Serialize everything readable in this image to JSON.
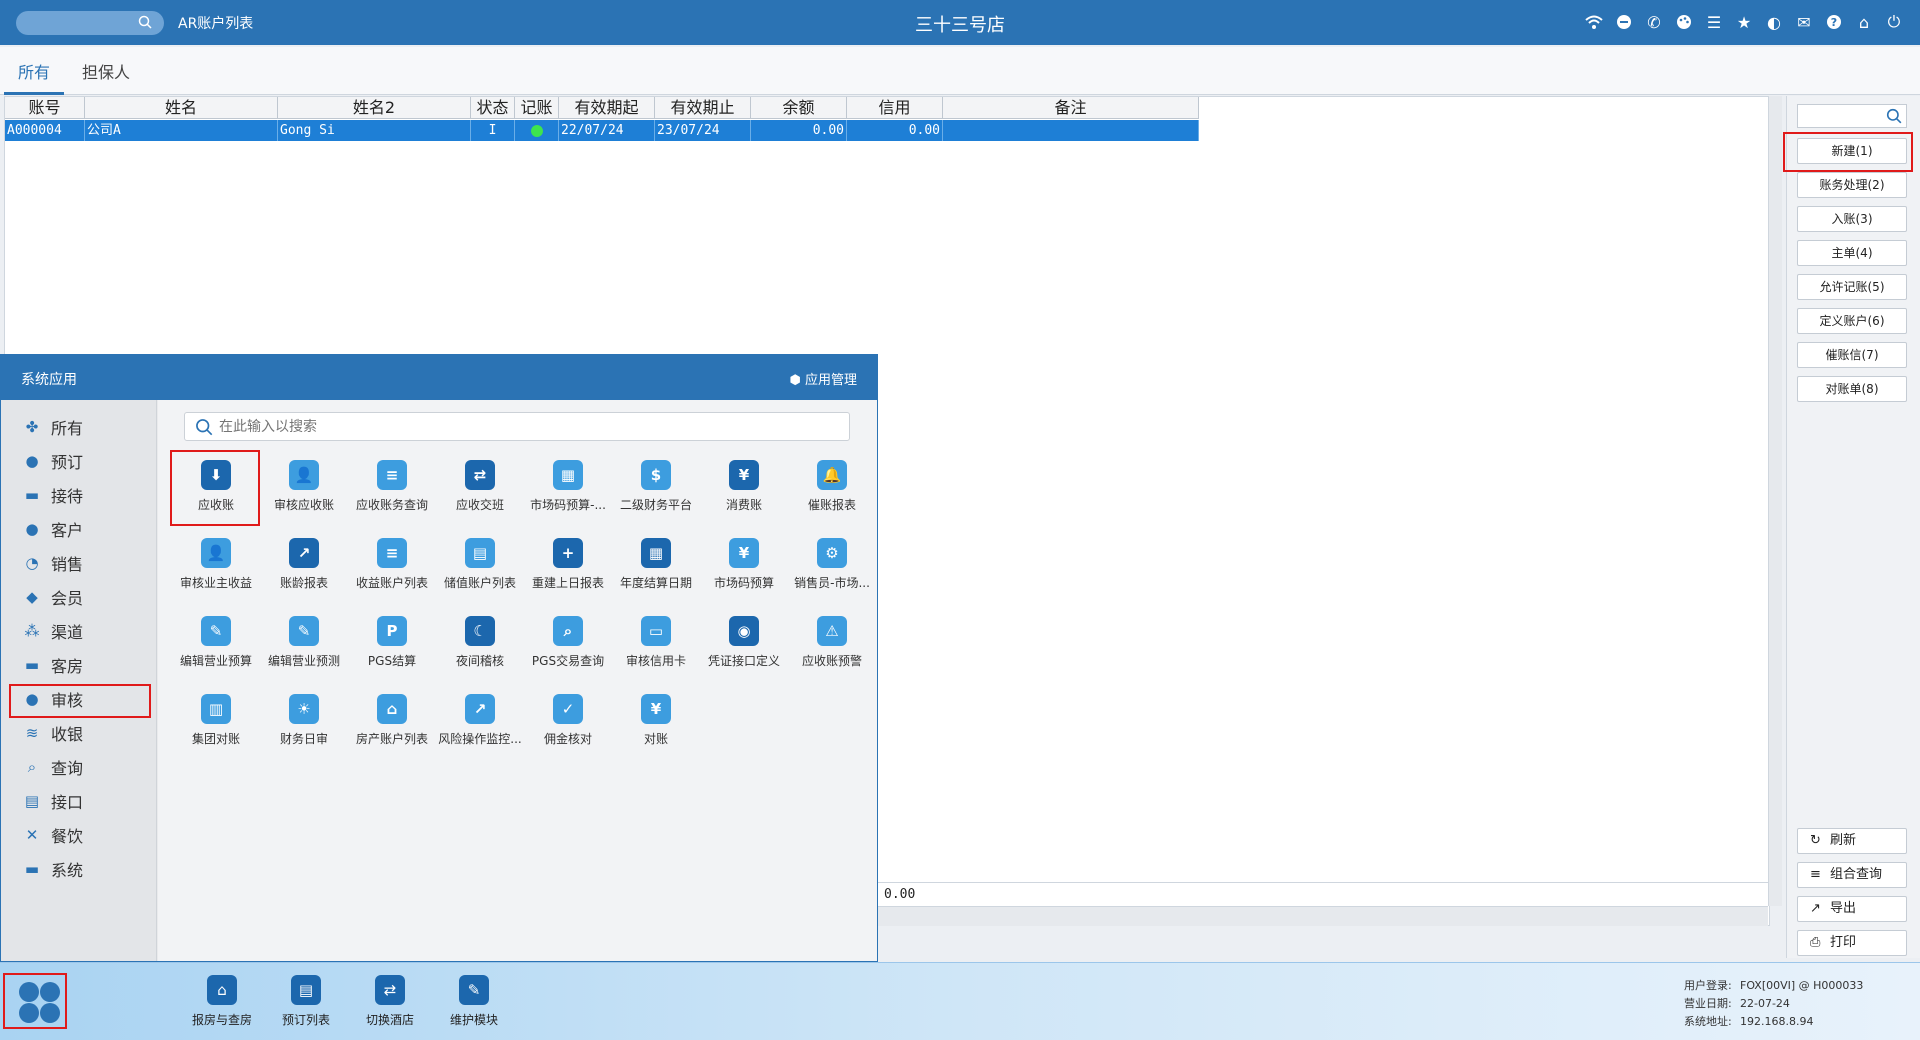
{
  "topbar": {
    "window_title": "AR账户列表",
    "store_name": "三十三号店",
    "icons": [
      "wifi-icon",
      "chat-icon",
      "phone-icon",
      "palette-icon",
      "menu-icon",
      "star-icon",
      "theme-icon",
      "mail-icon",
      "help-icon",
      "home-icon",
      "power-icon"
    ]
  },
  "tabs": [
    {
      "label": "所有"
    },
    {
      "label": "担保人"
    }
  ],
  "grid": {
    "columns": [
      "账号",
      "姓名",
      "姓名2",
      "状态",
      "记账",
      "有效期起",
      "有效期止",
      "余额",
      "信用",
      "备注"
    ],
    "rows": [
      {
        "account": "A000004",
        "name": "公司A",
        "name2": "Gong Si",
        "status": "I",
        "posting": "green",
        "valid_from": "22/07/24",
        "valid_to": "23/07/24",
        "balance": "0.00",
        "credit": "0.00",
        "remark": ""
      }
    ],
    "summary_value": "0.00"
  },
  "right_panel": {
    "search_placeholder": "",
    "buttons": [
      "新建(1)",
      "账务处理(2)",
      "入账(3)",
      "主单(4)",
      "允许记账(5)",
      "定义账户(6)",
      "催账信(7)",
      "对账单(8)"
    ],
    "bottom_buttons": [
      {
        "label": "刷新",
        "icon": "refresh-icon"
      },
      {
        "label": "组合查询",
        "icon": "list-icon"
      },
      {
        "label": "导出",
        "icon": "export-icon"
      },
      {
        "label": "打印",
        "icon": "print-icon"
      }
    ]
  },
  "app_menu": {
    "title": "系统应用",
    "manage_label": "应用管理",
    "search_placeholder": "在此输入以搜索",
    "categories": [
      "所有",
      "预订",
      "接待",
      "客户",
      "销售",
      "会员",
      "渠道",
      "客房",
      "审核",
      "收银",
      "查询",
      "接口",
      "餐饮",
      "系统"
    ],
    "selected_category": "审核",
    "apps": [
      {
        "label": "应收账",
        "color": "#1c67ad",
        "glyph": "⬇"
      },
      {
        "label": "审核应收账",
        "color": "#3d9ddf",
        "glyph": "👤"
      },
      {
        "label": "应收账务查询",
        "color": "#3d9ddf",
        "glyph": "≡"
      },
      {
        "label": "应收交班",
        "color": "#1c67ad",
        "glyph": "⇄"
      },
      {
        "label": "市场码预算-...",
        "color": "#3d9ddf",
        "glyph": "▦"
      },
      {
        "label": "二级财务平台",
        "color": "#3d9ddf",
        "glyph": "$"
      },
      {
        "label": "消费账",
        "color": "#1c67ad",
        "glyph": "¥"
      },
      {
        "label": "催账报表",
        "color": "#3d9ddf",
        "glyph": "🔔"
      },
      {
        "label": "审核业主收益",
        "color": "#3d9ddf",
        "glyph": "👤"
      },
      {
        "label": "账龄报表",
        "color": "#1c67ad",
        "glyph": "↗"
      },
      {
        "label": "收益账户列表",
        "color": "#3d9ddf",
        "glyph": "≡"
      },
      {
        "label": "储值账户列表",
        "color": "#3d9ddf",
        "glyph": "▤"
      },
      {
        "label": "重建上日报表",
        "color": "#1c67ad",
        "glyph": "+"
      },
      {
        "label": "年度结算日期",
        "color": "#1c67ad",
        "glyph": "▦"
      },
      {
        "label": "市场码预算",
        "color": "#3d9ddf",
        "glyph": "¥"
      },
      {
        "label": "销售员-市场...",
        "color": "#3d9ddf",
        "glyph": "⚙"
      },
      {
        "label": "编辑营业预算",
        "color": "#3d9ddf",
        "glyph": "✎"
      },
      {
        "label": "编辑营业预测",
        "color": "#3d9ddf",
        "glyph": "✎"
      },
      {
        "label": "PGS结算",
        "color": "#3d9ddf",
        "glyph": "P"
      },
      {
        "label": "夜间稽核",
        "color": "#1c67ad",
        "glyph": "☾"
      },
      {
        "label": "PGS交易查询",
        "color": "#3d9ddf",
        "glyph": "⌕"
      },
      {
        "label": "审核信用卡",
        "color": "#3d9ddf",
        "glyph": "▭"
      },
      {
        "label": "凭证接口定义",
        "color": "#1c67ad",
        "glyph": "◉"
      },
      {
        "label": "应收账预警",
        "color": "#3d9ddf",
        "glyph": "⚠"
      },
      {
        "label": "集团对账",
        "color": "#3d9ddf",
        "glyph": "▥"
      },
      {
        "label": "财务日审",
        "color": "#3d9ddf",
        "glyph": "☀"
      },
      {
        "label": "房产账户列表",
        "color": "#3d9ddf",
        "glyph": "⌂"
      },
      {
        "label": "风险操作监控...",
        "color": "#3d9ddf",
        "glyph": "↗"
      },
      {
        "label": "佣金核对",
        "color": "#3d9ddf",
        "glyph": "✓"
      },
      {
        "label": "对账",
        "color": "#3d9ddf",
        "glyph": "¥"
      }
    ]
  },
  "bottombar": {
    "apps": [
      {
        "label": "报房与查房",
        "glyph": "⌂"
      },
      {
        "label": "预订列表",
        "glyph": "▤"
      },
      {
        "label": "切换酒店",
        "glyph": "⇄"
      },
      {
        "label": "维护模块",
        "glyph": "✎"
      }
    ],
    "sysinfo": {
      "user_label": "用户登录:",
      "user_value": "FOX[00VI] @ H000033",
      "date_label": "营业日期:",
      "date_value": "22-07-24",
      "addr_label": "系统地址:",
      "addr_value": "192.168.8.94"
    }
  },
  "colors": {
    "accent": "#2b73b4",
    "selection": "#1e7fd6",
    "highlight": "#e01a1a",
    "posting_ok": "#3ee44e"
  }
}
